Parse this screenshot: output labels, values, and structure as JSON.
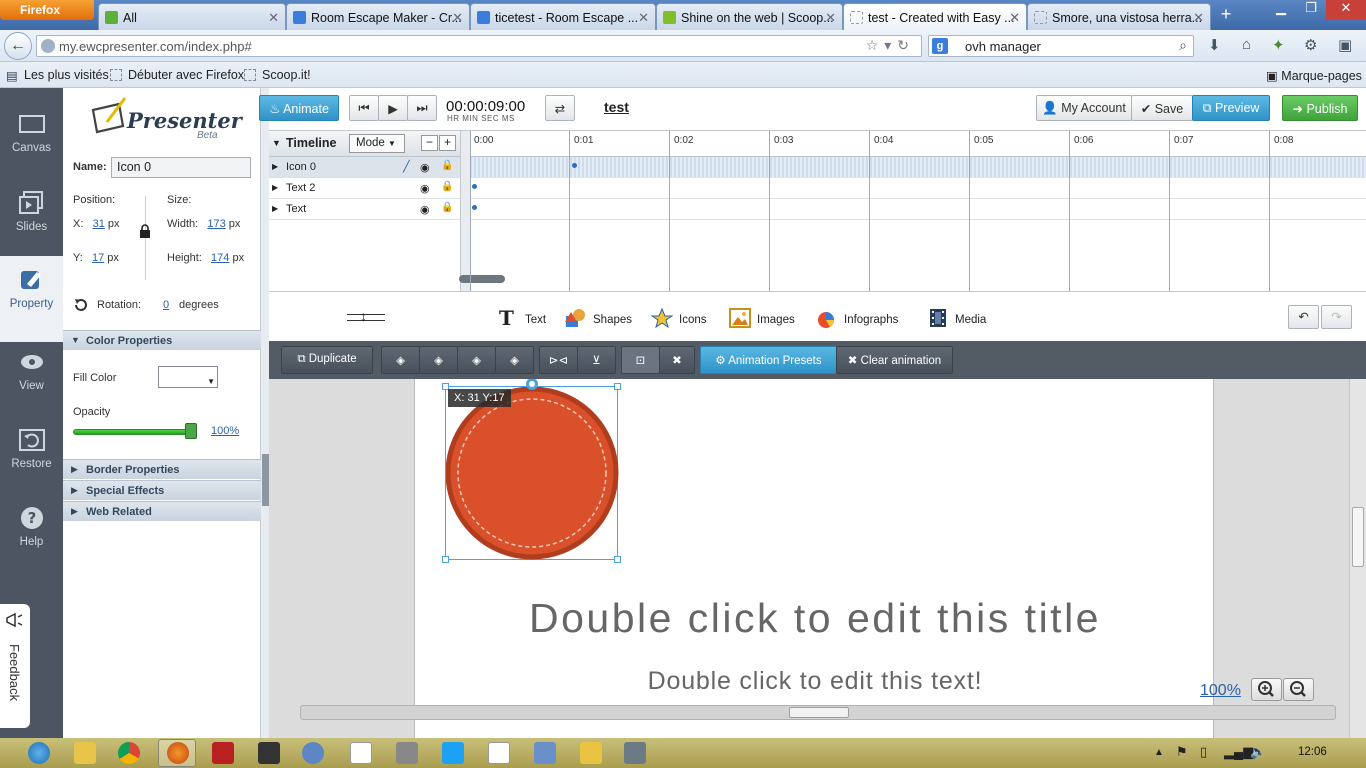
{
  "browser": {
    "menu_label": "Firefox",
    "tabs": [
      {
        "title": "All",
        "icon_color": "#5fae3c",
        "active": false
      },
      {
        "title": "Room Escape Maker - Cr...",
        "icon_color": "#3b7ddd",
        "active": false
      },
      {
        "title": "ticetest - Room Escape ...",
        "icon_color": "#3b7ddd",
        "active": false
      },
      {
        "title": "Shine on the web | Scoop...",
        "icon_color": "#7fbf2a",
        "active": false
      },
      {
        "title": "test - Created with Easy ...",
        "icon_color": "#bbbbbb",
        "active": true
      },
      {
        "title": "Smore, una vistosa herra...",
        "icon_color": "#bbbbbb",
        "active": false
      }
    ],
    "url": "my.ewcpresenter.com/index.php#",
    "search_value": "ovh manager",
    "bookmarks": [
      "Les plus visités",
      "Débuter avec Firefox",
      "Scoop.it!"
    ],
    "bookmarks_menu": "Marque-pages"
  },
  "sidebar": {
    "items": [
      {
        "label": "Canvas",
        "icon": "canvas-icon"
      },
      {
        "label": "Slides",
        "icon": "slides-icon"
      },
      {
        "label": "Property",
        "icon": "property-icon",
        "active": true
      },
      {
        "label": "View",
        "icon": "eye-icon"
      },
      {
        "label": "Restore",
        "icon": "restore-icon"
      },
      {
        "label": "Help",
        "icon": "help-icon"
      }
    ],
    "feedback": "Feedback"
  },
  "logo": {
    "name": "Presenter",
    "sub": "Beta"
  },
  "properties": {
    "name_label": "Name:",
    "name_value": "Icon 0",
    "position_label": "Position:",
    "size_label": "Size:",
    "x_label": "X:",
    "x_value": "31",
    "y_label": "Y:",
    "y_value": "17",
    "width_label": "Width:",
    "width_value": "173",
    "height_label": "Height:",
    "height_value": "174",
    "unit": "px",
    "rotation_label": "Rotation:",
    "rotation_value": "0",
    "rotation_unit": "degrees",
    "color_section": "Color Properties",
    "fill_color_label": "Fill Color",
    "opacity_label": "Opacity",
    "opacity_value": "100%",
    "sections": [
      "Border Properties",
      "Special Effects",
      "Web Related"
    ]
  },
  "toolbar": {
    "animate": "Animate",
    "timecode": "00:00:09:00",
    "time_units": "HR  MIN  SEC  MS",
    "project_title": "test",
    "my_account": "My Account",
    "save": "Save",
    "preview": "Preview",
    "publish": "Publish"
  },
  "timeline": {
    "title": "Timeline",
    "mode": "Mode",
    "ticks": [
      "0:00",
      "0:01",
      "0:02",
      "0:03",
      "0:04",
      "0:05",
      "0:06",
      "0:07",
      "0:08"
    ],
    "layers": [
      {
        "name": "Icon 0",
        "selected": true,
        "keyframe_time": 1.0
      },
      {
        "name": "Text 2",
        "selected": false,
        "keyframe_time": 0.0
      },
      {
        "name": "Text",
        "selected": false,
        "keyframe_time": 0.0
      }
    ]
  },
  "insert": {
    "items": [
      {
        "label": "Text",
        "icon": "text-icon"
      },
      {
        "label": "Shapes",
        "icon": "shapes-icon"
      },
      {
        "label": "Icons",
        "icon": "star-icon"
      },
      {
        "label": "Images",
        "icon": "image-icon"
      },
      {
        "label": "Infographs",
        "icon": "infograph-icon"
      },
      {
        "label": "Media",
        "icon": "film-icon"
      }
    ]
  },
  "edit": {
    "duplicate": "Duplicate",
    "animation_presets": "Animation Presets",
    "clear_animation": "Clear animation"
  },
  "canvas": {
    "coord_tooltip": "X: 31 Y:17",
    "title_text": "Double click to edit this title",
    "body_text": "Double click to edit this text!",
    "zoom": "100%",
    "circle_color": "#d9502a"
  },
  "taskbar": {
    "clock": "12:06"
  }
}
